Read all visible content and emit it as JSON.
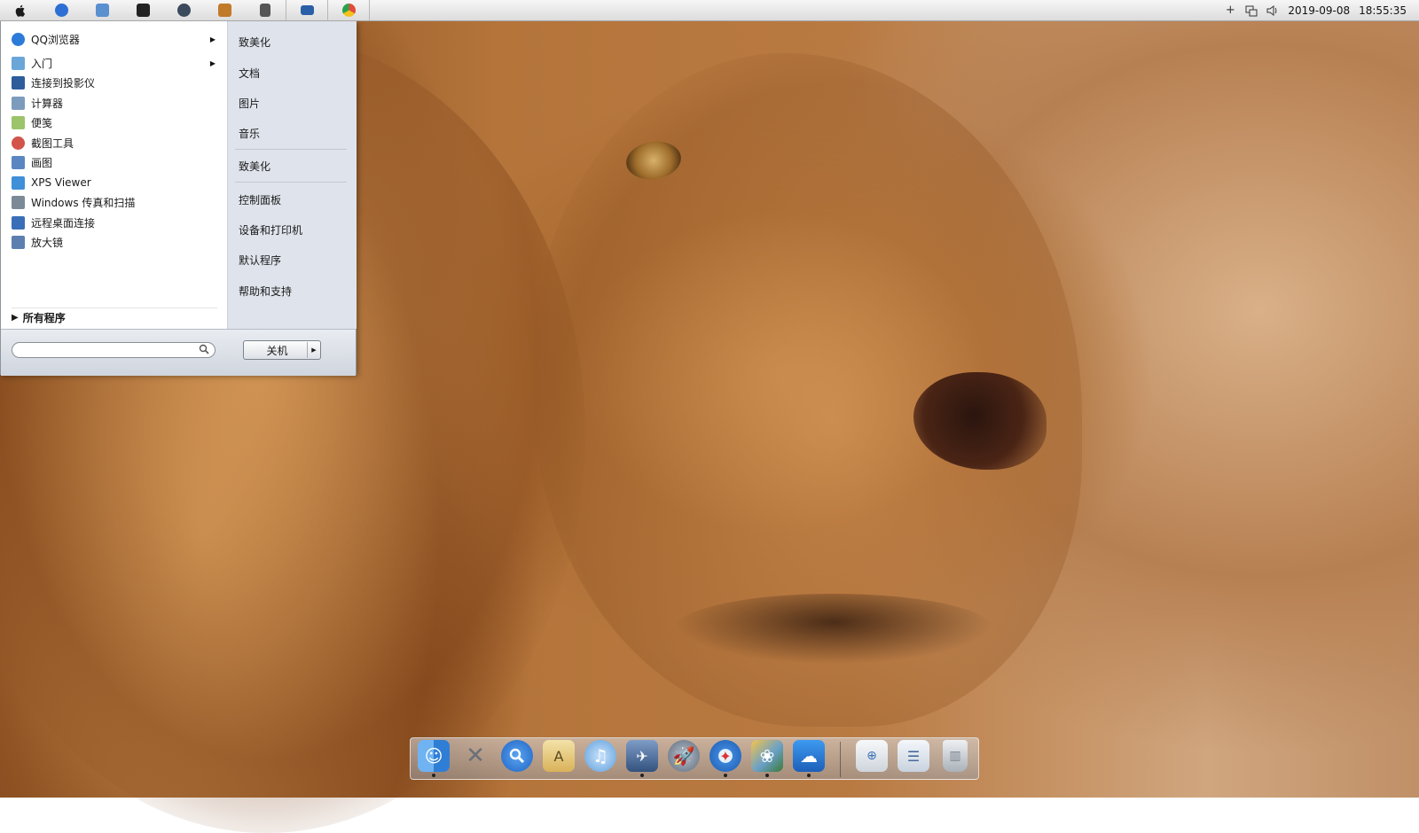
{
  "menubar": {
    "apple_icon": "apple-logo-icon",
    "apps": [
      {
        "name": "qq-browser-icon",
        "color": "#2d6fd4"
      },
      {
        "name": "itunes-icon",
        "color": "#5a8fd0"
      },
      {
        "name": "terminal-icon",
        "color": "#222222"
      },
      {
        "name": "dashboard-icon",
        "color": "#3b4a5c"
      },
      {
        "name": "photo-app-icon",
        "color": "#c07a2a"
      },
      {
        "name": "utilities-icon",
        "color": "#555555"
      },
      {
        "name": "monitor-icon",
        "color": "#2a5fa8"
      },
      {
        "name": "chrome-icon",
        "color": "#e14b3b"
      }
    ],
    "date": "2019-09-08",
    "time": "18:55:35"
  },
  "start_menu": {
    "programs": [
      {
        "label": "QQ浏览器",
        "has_submenu": true,
        "icon": "qq-browser-icon",
        "color": "#2d7bd8"
      },
      {
        "label": "入门",
        "has_submenu": true,
        "icon": "getting-started-icon",
        "color": "#6aa6d8"
      },
      {
        "label": "连接到投影仪",
        "has_submenu": false,
        "icon": "projector-icon",
        "color": "#2e5d9c"
      },
      {
        "label": "计算器",
        "has_submenu": false,
        "icon": "calculator-icon",
        "color": "#7d9bbd"
      },
      {
        "label": "便笺",
        "has_submenu": false,
        "icon": "sticky-notes-icon",
        "color": "#9cc46b"
      },
      {
        "label": "截图工具",
        "has_submenu": false,
        "icon": "snipping-tool-icon",
        "color": "#d2544a"
      },
      {
        "label": "画图",
        "has_submenu": false,
        "icon": "paint-icon",
        "color": "#5a86c2"
      },
      {
        "label": "XPS Viewer",
        "has_submenu": false,
        "icon": "xps-viewer-icon",
        "color": "#3f8fd9"
      },
      {
        "label": "Windows 传真和扫描",
        "has_submenu": false,
        "icon": "fax-scan-icon",
        "color": "#7c8a98"
      },
      {
        "label": "远程桌面连接",
        "has_submenu": false,
        "icon": "remote-desktop-icon",
        "color": "#3a6fb8"
      },
      {
        "label": "放大镜",
        "has_submenu": false,
        "icon": "magnifier-icon",
        "color": "#5c7fb0"
      }
    ],
    "all_programs": "所有程序",
    "right_links": [
      "致美化",
      "文档",
      "图片",
      "音乐",
      "致美化",
      "控制面板",
      "设备和打印机",
      "默认程序",
      "帮助和支持"
    ],
    "search_placeholder": "",
    "shutdown_label": "关机"
  },
  "dock": {
    "items": [
      {
        "name": "finder-icon",
        "color": "#3a8ee6",
        "running": true
      },
      {
        "name": "utilities-tools-icon",
        "color": "#8a8f96",
        "running": false
      },
      {
        "name": "spotlight-search-icon",
        "color": "#2f7de0",
        "running": false
      },
      {
        "name": "textedit-icon",
        "color": "#d9b25a",
        "running": false
      },
      {
        "name": "itunes-icon",
        "color": "#7db2e8",
        "running": false
      },
      {
        "name": "preview-icon",
        "color": "#4b6fa0",
        "running": true
      },
      {
        "name": "launchpad-icon",
        "color": "#7b8796",
        "running": false
      },
      {
        "name": "safari-icon",
        "color": "#3b83d8",
        "running": true
      },
      {
        "name": "iphoto-icon",
        "color": "#6aa0c8",
        "running": true
      },
      {
        "name": "weather-icon",
        "color": "#2a7fd6",
        "running": true
      }
    ],
    "right_items": [
      {
        "name": "network-folder-icon",
        "color": "#e3e6ea"
      },
      {
        "name": "documents-stack-icon",
        "color": "#d6dde6"
      },
      {
        "name": "trash-icon",
        "color": "#c7ccd2"
      }
    ]
  }
}
